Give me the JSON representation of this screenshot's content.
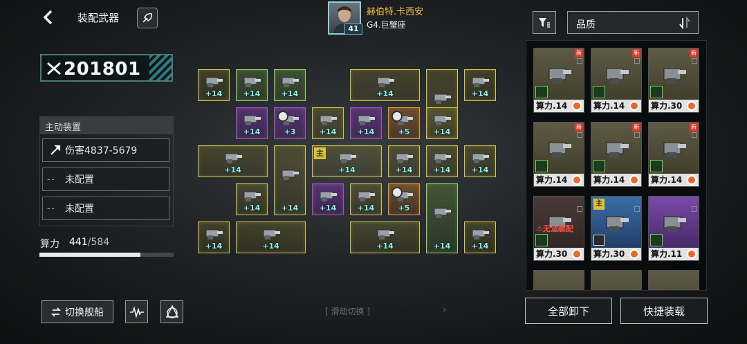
{
  "header": {
    "title": "装配武器",
    "pilot_name": "赫伯特.卡西安",
    "pilot_level": "41",
    "ship_name": "G4.巨蟹座"
  },
  "left_panel": {
    "combat_power": "201801",
    "active_device_header": "主动装置",
    "slots": [
      {
        "label": "伤害4837-5679",
        "icon": "missile-icon"
      },
      {
        "label": "未配置",
        "prefix": "--"
      },
      {
        "label": "未配置",
        "prefix": "--"
      }
    ],
    "compute_label": "算力",
    "compute_current": "441",
    "compute_max": "/584",
    "compute_fraction": 0.755,
    "switch_ship_label": "切换舰船"
  },
  "grid": {
    "slide_hint": "滑动切换",
    "main_tag": "主",
    "cells": [
      {
        "level": "+14",
        "quality": "yellow"
      },
      {
        "level": "+14",
        "quality": "green"
      },
      {
        "level": "+14",
        "quality": "green"
      },
      {
        "level": "+14",
        "quality": "yellow"
      },
      {
        "level": "+14",
        "quality": "yellow"
      },
      {
        "level": "+14",
        "quality": "yellow"
      },
      {
        "level": "+14",
        "quality": "purple"
      },
      {
        "level": "+3",
        "quality": "purple"
      },
      {
        "level": "+14",
        "quality": "yellow"
      },
      {
        "level": "+14",
        "quality": "purple"
      },
      {
        "level": "+5",
        "quality": "orange"
      },
      {
        "level": "+14",
        "quality": "yellow"
      },
      {
        "level": "+14",
        "quality": "yellow"
      },
      {
        "level": "+14",
        "quality": "yellow"
      },
      {
        "level": "+14",
        "quality": "yellow"
      },
      {
        "level": "+14",
        "quality": "yellow"
      },
      {
        "level": "+14",
        "quality": "yellow"
      },
      {
        "level": "+14",
        "quality": "yellow"
      },
      {
        "level": "+14",
        "quality": "purple"
      },
      {
        "level": "+14",
        "quality": "yellow"
      },
      {
        "level": "+5",
        "quality": "orange"
      },
      {
        "level": "+14",
        "quality": "green"
      },
      {
        "level": "+14",
        "quality": "yellow"
      },
      {
        "level": "+14",
        "quality": "yellow"
      },
      {
        "level": "+14",
        "quality": "yellow"
      },
      {
        "level": "+14",
        "quality": "yellow"
      },
      {
        "level": "+14",
        "quality": "yellow"
      }
    ]
  },
  "right_panel": {
    "sort_label": "品质",
    "cards": [
      {
        "footer": "算力.14",
        "new": "新",
        "quality": "yellow"
      },
      {
        "footer": "算力.14",
        "new": "新",
        "quality": "yellow"
      },
      {
        "footer": "算力.30",
        "new": "新",
        "quality": "yellow"
      },
      {
        "footer": "算力.14",
        "new": "新",
        "quality": "yellow"
      },
      {
        "footer": "算力.14",
        "new": "新",
        "quality": "yellow"
      },
      {
        "footer": "算力.14",
        "new": "新",
        "quality": "yellow"
      },
      {
        "footer": "算力.30",
        "warning": "无法装配",
        "quality": "dark"
      },
      {
        "footer": "算力.30",
        "main": "主",
        "quality": "blue"
      },
      {
        "footer": "算力.11",
        "quality": "purple"
      }
    ],
    "unload_all_label": "全部卸下",
    "quick_equip_label": "快捷装载"
  }
}
